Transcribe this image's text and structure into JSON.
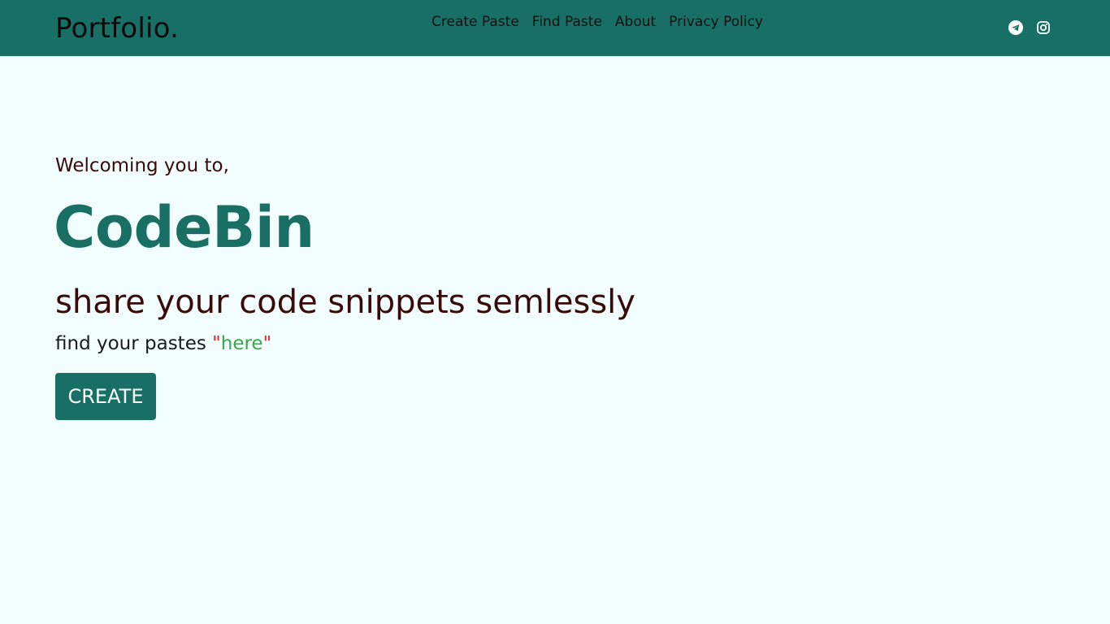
{
  "navbar": {
    "brand": "Portfolio.",
    "links": [
      {
        "label": "Create Paste"
      },
      {
        "label": "Find Paste"
      },
      {
        "label": "About"
      },
      {
        "label": "Privacy Policy"
      }
    ],
    "social": [
      {
        "icon": "telegram-icon"
      },
      {
        "icon": "instagram-icon"
      }
    ]
  },
  "hero": {
    "welcome": "Welcoming you to,",
    "title": "CodeBin",
    "tagline": "share your code snippets semlessly",
    "find_prefix": "find your pastes ",
    "quote_open": "\"",
    "here_link": "here",
    "quote_close": "\"",
    "create_button": "CREATE"
  },
  "colors": {
    "navbar_bg": "#186f66",
    "page_bg": "#f1fefd",
    "title": "#1a6f64",
    "text_dark_red": "#3a0a0a",
    "link_green": "#3aa64a",
    "quote_red": "#e3242b"
  }
}
